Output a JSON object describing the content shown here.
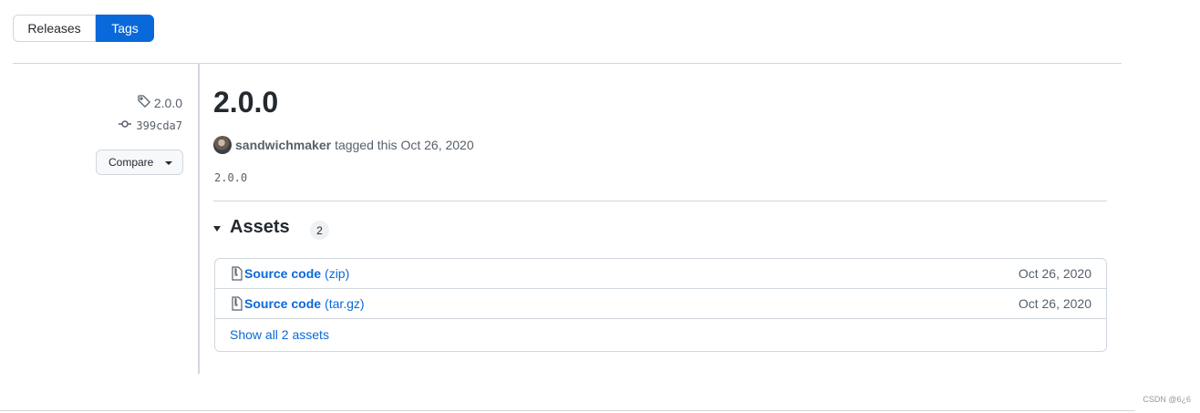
{
  "tabs": {
    "releases": "Releases",
    "tags": "Tags"
  },
  "sidebar": {
    "tag": "2.0.0",
    "commit": "399cda7",
    "compare": "Compare"
  },
  "release": {
    "title": "2.0.0",
    "author": "sandwichmaker",
    "tagged_text": "tagged this Oct 26, 2020",
    "body": "2.0.0"
  },
  "assets": {
    "heading": "Assets",
    "count": "2",
    "items": [
      {
        "name": "Source code",
        "ext": "(zip)",
        "date": "Oct 26, 2020"
      },
      {
        "name": "Source code",
        "ext": "(tar.gz)",
        "date": "Oct 26, 2020"
      }
    ],
    "show_all": "Show all 2 assets"
  },
  "watermark": "CSDN @6¿6",
  "colors": {
    "accent": "#0969da",
    "border": "#d0d7de",
    "muted": "#57606a"
  }
}
